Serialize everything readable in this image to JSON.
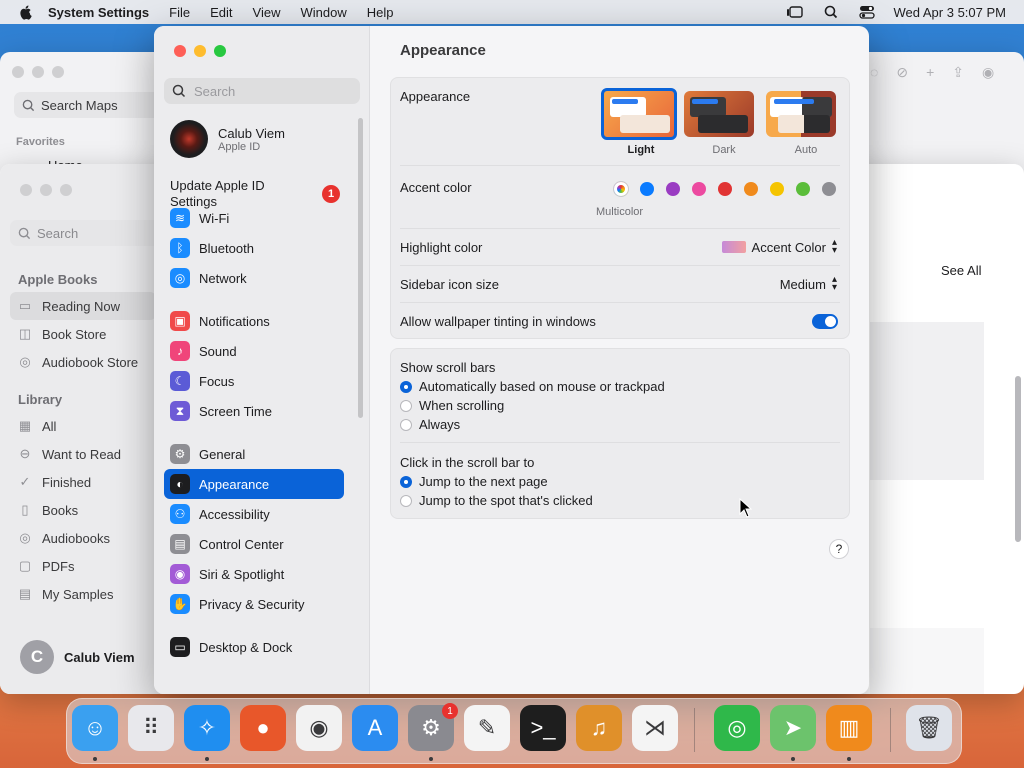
{
  "menubar": {
    "app_name": "System Settings",
    "menus": [
      "File",
      "Edit",
      "View",
      "Window",
      "Help"
    ],
    "datetime": "Wed Apr 3  5:07 PM"
  },
  "maps_window": {
    "search_placeholder": "Search Maps",
    "favorites_label": "Favorites",
    "home_label": "Home"
  },
  "books_window": {
    "search_placeholder": "Search",
    "section_books": "Apple Books",
    "items_top": [
      {
        "label": "Reading Now",
        "icon": "book-open-icon"
      },
      {
        "label": "Book Store",
        "icon": "bag-icon"
      },
      {
        "label": "Audiobook Store",
        "icon": "headphones-icon"
      }
    ],
    "section_library": "Library",
    "items_library": [
      {
        "label": "All",
        "icon": "grid-icon"
      },
      {
        "label": "Want to Read",
        "icon": "arrow-circle-icon"
      },
      {
        "label": "Finished",
        "icon": "check-circle-icon"
      },
      {
        "label": "Books",
        "icon": "book-icon"
      },
      {
        "label": "Audiobooks",
        "icon": "headphones-icon"
      },
      {
        "label": "PDFs",
        "icon": "doc-icon"
      },
      {
        "label": "My Samples",
        "icon": "samples-icon"
      }
    ],
    "user_initial": "C",
    "user_name": "Calub Viem",
    "see_all": "See All"
  },
  "settings": {
    "search_placeholder": "Search",
    "account": {
      "name": "Calub Viem",
      "subtitle": "Apple ID"
    },
    "update": {
      "label": "Update Apple ID Settings",
      "badge": "1"
    },
    "sidebar_groups": [
      [
        {
          "label": "Wi-Fi",
          "color": "#1a8cff",
          "glyph": "≋"
        },
        {
          "label": "Bluetooth",
          "color": "#1a8cff",
          "glyph": "ᛒ"
        },
        {
          "label": "Network",
          "color": "#1a8cff",
          "glyph": "◎"
        }
      ],
      [
        {
          "label": "Notifications",
          "color": "#f04a4a",
          "glyph": "▣"
        },
        {
          "label": "Sound",
          "color": "#f0457a",
          "glyph": "♪"
        },
        {
          "label": "Focus",
          "color": "#5b5bd6",
          "glyph": "☾"
        },
        {
          "label": "Screen Time",
          "color": "#6e5bd6",
          "glyph": "⧗"
        }
      ],
      [
        {
          "label": "General",
          "color": "#8e8e93",
          "glyph": "⚙"
        },
        {
          "label": "Appearance",
          "color": "#1d1d1f",
          "glyph": "◐",
          "selected": true
        },
        {
          "label": "Accessibility",
          "color": "#1a8cff",
          "glyph": "⚇"
        },
        {
          "label": "Control Center",
          "color": "#8e8e93",
          "glyph": "▤"
        },
        {
          "label": "Siri & Spotlight",
          "color": "#a35bd6",
          "glyph": "◉"
        },
        {
          "label": "Privacy & Security",
          "color": "#1a8cff",
          "glyph": "✋"
        }
      ],
      [
        {
          "label": "Desktop & Dock",
          "color": "#1d1d1f",
          "glyph": "▭"
        }
      ]
    ],
    "page_title": "Appearance",
    "appearance": {
      "label": "Appearance",
      "options": [
        "Light",
        "Dark",
        "Auto"
      ],
      "selected": "Light"
    },
    "accent": {
      "label": "Accent color",
      "caption": "Multicolor",
      "colors": [
        "#ffffff",
        "#0a7bff",
        "#9a3cc2",
        "#ec4aa0",
        "#e13434",
        "#f08a1c",
        "#f5c400",
        "#5bbd3a",
        "#8e8e93"
      ]
    },
    "highlight": {
      "label": "Highlight color",
      "value": "Accent Color"
    },
    "sidebar_size": {
      "label": "Sidebar icon size",
      "value": "Medium"
    },
    "tinting": {
      "label": "Allow wallpaper tinting in windows",
      "on": true
    },
    "scroll_bars": {
      "label": "Show scroll bars",
      "options": [
        "Automatically based on mouse or trackpad",
        "When scrolling",
        "Always"
      ],
      "selected": 0
    },
    "click_scroll": {
      "label": "Click in the scroll bar to",
      "options": [
        "Jump to the next page",
        "Jump to the spot that's clicked"
      ],
      "selected": 0
    },
    "help": "?"
  },
  "dock": {
    "apps": [
      {
        "name": "Finder",
        "icon": "finder-icon",
        "bg": "#3aa0f0",
        "glyph": "☺",
        "running": true
      },
      {
        "name": "Launchpad",
        "icon": "launchpad-icon",
        "bg": "#e8e8ec",
        "glyph": "⠿",
        "running": false
      },
      {
        "name": "Safari",
        "icon": "safari-icon",
        "bg": "#1f8ef0",
        "glyph": "✧",
        "running": true
      },
      {
        "name": "Firefox",
        "icon": "firefox-icon",
        "bg": "#e8572a",
        "glyph": "●",
        "running": false
      },
      {
        "name": "Chrome",
        "icon": "chrome-icon",
        "bg": "#f2f2f2",
        "glyph": "◉",
        "running": false
      },
      {
        "name": "App Store",
        "icon": "app-store-icon",
        "bg": "#2b8cf0",
        "glyph": "A",
        "running": false
      },
      {
        "name": "System Settings",
        "icon": "system-settings-icon",
        "bg": "#8a8a90",
        "glyph": "⚙",
        "running": true,
        "badge": "1"
      },
      {
        "name": "TextEdit",
        "icon": "textedit-icon",
        "bg": "#f4f4f4",
        "glyph": "✎",
        "running": false
      },
      {
        "name": "Terminal",
        "icon": "terminal-icon",
        "bg": "#1e1e1e",
        "glyph": ">_",
        "running": false
      },
      {
        "name": "GarageBand",
        "icon": "garageband-icon",
        "bg": "#e0902a",
        "glyph": "♫",
        "running": false
      },
      {
        "name": "VS Code",
        "icon": "vscode-icon",
        "bg": "#f4f4f4",
        "glyph": "⋊",
        "running": false
      },
      {
        "name": "Find My",
        "icon": "find-my-icon",
        "bg": "#2fb84a",
        "glyph": "◎",
        "running": false
      },
      {
        "name": "Maps",
        "icon": "maps-icon",
        "bg": "#6cc36c",
        "glyph": "➤",
        "running": true
      },
      {
        "name": "Books",
        "icon": "books-icon",
        "bg": "#f08a1c",
        "glyph": "▥",
        "running": true
      },
      {
        "name": "Trash",
        "icon": "trash-icon",
        "bg": "#dfe3ea",
        "glyph": "🗑",
        "running": false
      }
    ]
  }
}
